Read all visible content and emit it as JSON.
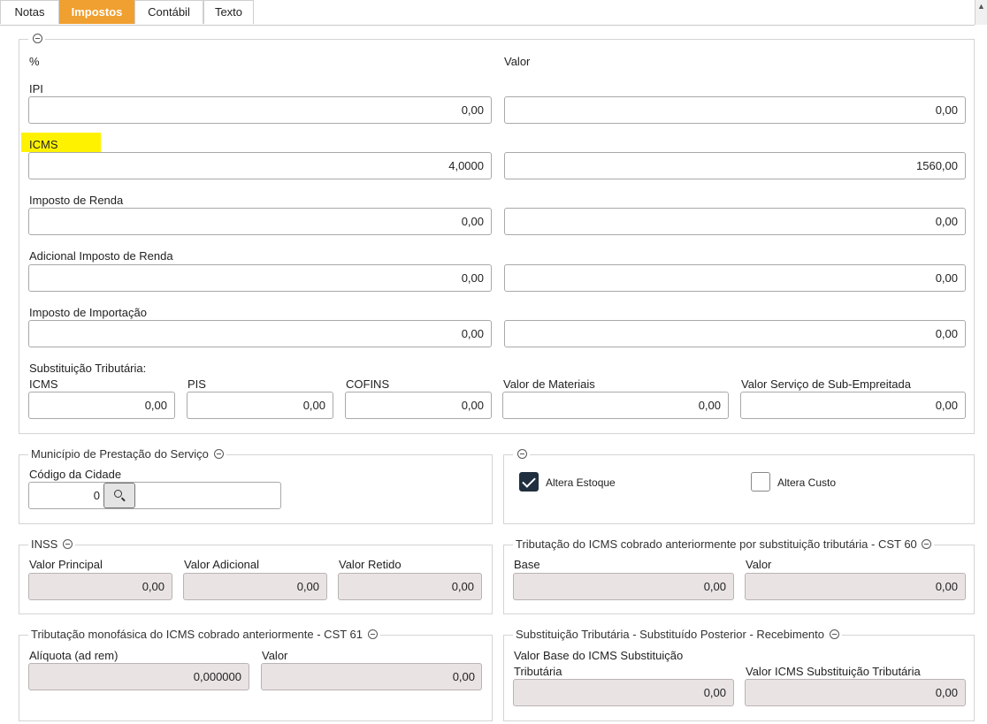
{
  "tabs": [
    {
      "label": "Notas"
    },
    {
      "label": "Impostos"
    },
    {
      "label": "Contábil"
    },
    {
      "label": "Texto"
    }
  ],
  "active_tab": "Impostos",
  "impostos": {
    "col_percent": "%",
    "col_valor": "Valor",
    "rows": [
      {
        "label": "IPI",
        "percent": "0,00",
        "valor": "0,00"
      },
      {
        "label": "ICMS",
        "percent": "4,0000",
        "valor": "1560,00"
      },
      {
        "label": "Imposto de Renda",
        "percent": "0,00",
        "valor": "0,00"
      },
      {
        "label": "Adicional Imposto de Renda",
        "percent": "0,00",
        "valor": "0,00"
      },
      {
        "label": "Imposto de Importação",
        "percent": "0,00",
        "valor": "0,00"
      }
    ],
    "subst_title": "Substituição Tributária:",
    "subst_fields": [
      {
        "label": "ICMS",
        "value": "0,00"
      },
      {
        "label": "PIS",
        "value": "0,00"
      },
      {
        "label": "COFINS",
        "value": "0,00"
      },
      {
        "label": "Valor de Materiais",
        "value": "0,00"
      },
      {
        "label": "Valor Serviço de Sub-Empreitada",
        "value": "0,00"
      }
    ]
  },
  "municipio": {
    "title": "Município de Prestação do Serviço",
    "codigo_label": "Código da Cidade",
    "codigo_value": "0",
    "cidade_name": ""
  },
  "flags": {
    "altera_estoque": {
      "label": "Altera Estoque",
      "checked": true
    },
    "altera_custo": {
      "label": "Altera Custo",
      "checked": false
    }
  },
  "inss": {
    "title": "INSS",
    "fields": [
      {
        "label": "Valor Principal",
        "value": "0,00"
      },
      {
        "label": "Valor Adicional",
        "value": "0,00"
      },
      {
        "label": "Valor Retido",
        "value": "0,00"
      }
    ]
  },
  "cst60": {
    "title": "Tributação do ICMS cobrado anteriormente por substituição tributária - CST 60",
    "fields": [
      {
        "label": "Base",
        "value": "0,00"
      },
      {
        "label": "Valor",
        "value": "0,00"
      }
    ]
  },
  "cst61": {
    "title": "Tributação monofásica do ICMS cobrado anteriormente - CST 61",
    "fields": [
      {
        "label": "Alíquota (ad rem)",
        "value": "0,000000"
      },
      {
        "label": "Valor",
        "value": ""
      }
    ]
  },
  "st_receb": {
    "title": "Substituição Tributária - Substituído Posterior - Recebimento",
    "fields": [
      {
        "label_line1": "Valor Base do ICMS Substituição",
        "label_line2": "Tributária",
        "value": "0,00"
      },
      {
        "label": "Valor ICMS Substituição Tributária",
        "value": "0,00"
      }
    ]
  },
  "colors": {
    "active_tab": "#f0a030",
    "highlight": "#fff200",
    "readonly_field": "#e9e3e3",
    "checkbox_on": "#1f2f3f"
  }
}
